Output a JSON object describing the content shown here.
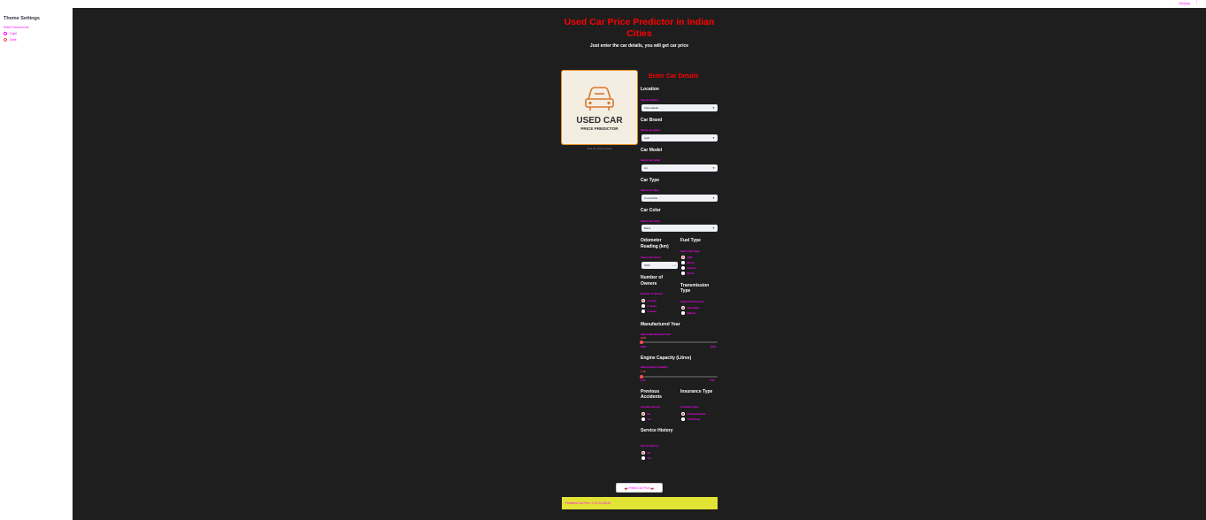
{
  "header": {
    "deploy_label": "Deploy",
    "menu_glyph": "⋮"
  },
  "sidebar": {
    "title": "Theme Settings",
    "choose_label": "Select Theme mode",
    "options": [
      {
        "label": "Light",
        "selected": false
      },
      {
        "label": "Dark",
        "selected": true
      }
    ]
  },
  "page": {
    "title_line1": "Used Car Price Predictor in Indian",
    "title_line2": "Cities",
    "subtitle": "Just enter the car details, you will get car price",
    "logo_text1": "USED CAR",
    "logo_text2": "PRICE PREDICTOR",
    "logo_caption": "Used Car Price Predictor",
    "section_heading": "Enter Car Details"
  },
  "form": {
    "location": {
      "heading": "Location",
      "label": "Select location",
      "value": "Ahmedabad"
    },
    "brand": {
      "heading": "Car Brand",
      "label": "Select car brand",
      "value": "Audi"
    },
    "model": {
      "heading": "Car Model",
      "label": "Select car model",
      "value": "A4"
    },
    "type": {
      "heading": "Car Type",
      "label": "Select Car Type",
      "value": "Convertible"
    },
    "color": {
      "heading": "Car Color",
      "label": "Select Car Color",
      "value": "Black"
    },
    "odometer": {
      "heading_line1": "Odometer",
      "heading_line2": "Reading (km)",
      "label": "Select Km driven",
      "value": "5000",
      "minus": "−",
      "plus": "+"
    },
    "fuel": {
      "heading": "Fuel Type",
      "label": "Select Fuel Type",
      "options": [
        "CNG",
        "Diesel",
        "Electric",
        "Petrol"
      ],
      "selected": 0
    },
    "owners": {
      "heading_line1": "Number of",
      "heading_line2": "Owners",
      "label": "Number of Owners",
      "options": [
        "1 owner",
        "2 owner",
        "3 owner"
      ],
      "selected": 0
    },
    "transmission": {
      "heading_line1": "Transmission",
      "heading_line2": "Type",
      "label": "Select Transmission",
      "options": [
        "Automatic",
        "Manual"
      ],
      "selected": 0
    },
    "year": {
      "heading": "Manufactured Year",
      "label": "Select Manufactured Year",
      "value": "2000",
      "min": "2000",
      "max": "2024"
    },
    "engine": {
      "heading": "Engine Capacity (Litres)",
      "label": "Select Engine Capacity",
      "value": "1.00",
      "min": "1.00",
      "max": "5.00"
    },
    "accidents": {
      "heading_line1": "Previous",
      "heading_line2": "Accidents",
      "label": "Accident History",
      "options": [
        "No",
        "Yes"
      ],
      "selected": 0
    },
    "insurance": {
      "heading": "Insurance Type",
      "label": "Insurance Type",
      "options": [
        "Comprehensive",
        "Third-Party"
      ],
      "selected": 0
    },
    "service": {
      "heading": "Service History",
      "label": "Service History",
      "options": [
        "No",
        "Yes"
      ],
      "selected": 0
    }
  },
  "predict_button": "🚗 Predict Car Price 🚗",
  "result_text": "Predicted Car Price: ₹ 23,76,446.56",
  "colors": {
    "accent": "#ff4b4b",
    "title_red": "#ff0000",
    "label_magenta": "#ff00ff",
    "background": "#1e1e1e",
    "result_bg": "#e2e435"
  }
}
